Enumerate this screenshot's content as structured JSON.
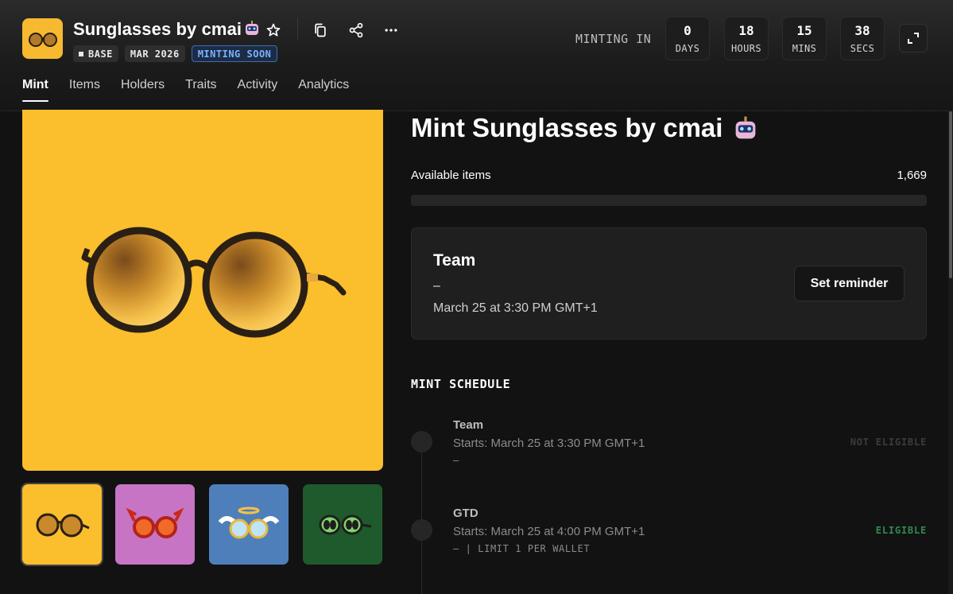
{
  "collection": {
    "title": "Sunglasses by cmai",
    "tags": {
      "chain": "BASE",
      "date": "MAR 2026",
      "status": "MINTING SOON"
    }
  },
  "header_icons": [
    "star-icon",
    "copy-icon",
    "share-icon",
    "more-icon"
  ],
  "countdown": {
    "label": "MINTING IN",
    "days": {
      "value": "0",
      "unit": "DAYS"
    },
    "hours": {
      "value": "18",
      "unit": "HOURS"
    },
    "mins": {
      "value": "15",
      "unit": "MINS"
    },
    "secs": {
      "value": "38",
      "unit": "SECS"
    }
  },
  "tabs": [
    "Mint",
    "Items",
    "Holders",
    "Traits",
    "Activity",
    "Analytics"
  ],
  "mint": {
    "title": "Mint Sunglasses by cmai",
    "available_label": "Available items",
    "available_value": "1,669",
    "progress_fraction": 0
  },
  "team_card": {
    "name": "Team",
    "price": "–",
    "date": "March 25 at 3:30 PM GMT+1",
    "reminder_label": "Set reminder"
  },
  "schedule": {
    "title": "MINT SCHEDULE",
    "phases": [
      {
        "name": "Team",
        "starts": "Starts: March 25 at 3:30 PM GMT+1",
        "sub": "–",
        "eligibility": "NOT ELIGIBLE"
      },
      {
        "name": "GTD",
        "starts": "Starts: March 25 at 4:00 PM GMT+1",
        "sub": "– | LIMIT 1 PER WALLET",
        "eligibility": "ELIGIBLE"
      }
    ]
  },
  "thumbnails": [
    "sunglasses-yellow",
    "sunglasses-crab",
    "sunglasses-angel",
    "sunglasses-alien"
  ],
  "colors": {
    "accent_yellow": "#fbbe2d",
    "thumb_pink": "#c774c4",
    "thumb_blue": "#4f7fba",
    "thumb_green": "#1e5a2c",
    "eligible_green": "#2f8a4f",
    "minting_blue": "#7ab3ff"
  }
}
